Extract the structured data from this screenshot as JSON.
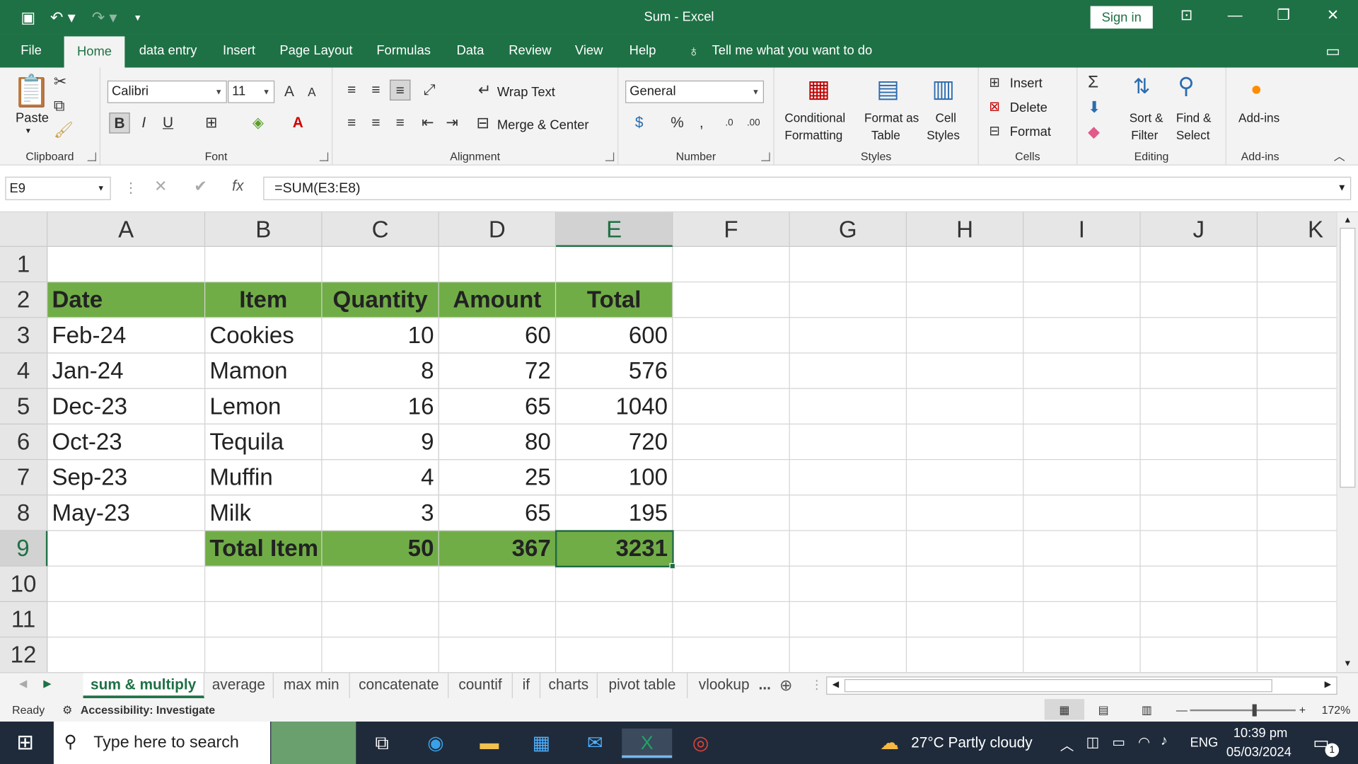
{
  "window": {
    "title": "Sum  -  Excel",
    "sign_in": "Sign in"
  },
  "menu_tabs": [
    "File",
    "Home",
    "data entry",
    "Insert",
    "Page Layout",
    "Formulas",
    "Data",
    "Review",
    "View",
    "Help"
  ],
  "tell_me": "Tell me what you want to do",
  "ribbon": {
    "clipboard": {
      "paste": "Paste",
      "label": "Clipboard"
    },
    "font": {
      "name": "Calibri",
      "size": "11",
      "label": "Font",
      "bold": "B",
      "italic": "I",
      "underline": "U"
    },
    "alignment": {
      "wrap": "Wrap Text",
      "merge": "Merge & Center",
      "label": "Alignment"
    },
    "number": {
      "format": "General",
      "label": "Number"
    },
    "styles": {
      "conditional": "Conditional",
      "conditional2": "Formatting",
      "format_as": "Format as",
      "format_as2": "Table",
      "cell": "Cell",
      "cell2": "Styles",
      "label": "Styles"
    },
    "cells": {
      "insert": "Insert",
      "delete": "Delete",
      "format": "Format",
      "label": "Cells"
    },
    "editing": {
      "sort": "Sort &",
      "sort2": "Filter",
      "find": "Find &",
      "find2": "Select",
      "label": "Editing"
    },
    "addins": {
      "addins": "Add-ins",
      "label": "Add-ins"
    }
  },
  "formula_bar": {
    "name_box": "E9",
    "formula": "=SUM(E3:E8)"
  },
  "columns": [
    "A",
    "B",
    "C",
    "D",
    "E",
    "F",
    "G",
    "H",
    "I",
    "J",
    "K"
  ],
  "rows": [
    "1",
    "2",
    "3",
    "4",
    "5",
    "6",
    "7",
    "8",
    "9",
    "10",
    "11",
    "12"
  ],
  "table": {
    "headers": [
      "Date",
      "Item",
      "Quantity",
      "Amount",
      "Total"
    ],
    "rows": [
      [
        "Feb-24",
        "Cookies",
        "10",
        "60",
        "600"
      ],
      [
        "Jan-24",
        "Mamon",
        "8",
        "72",
        "576"
      ],
      [
        "Dec-23",
        "Lemon",
        "16",
        "65",
        "1040"
      ],
      [
        "Oct-23",
        "Tequila",
        "9",
        "80",
        "720"
      ],
      [
        "Sep-23",
        "Muffin",
        "4",
        "25",
        "100"
      ],
      [
        "May-23",
        "Milk",
        "3",
        "65",
        "195"
      ]
    ],
    "total": {
      "label": "Total Item",
      "quantity": "50",
      "amount": "367",
      "total": "3231"
    }
  },
  "sheet_tabs": [
    "sum & multiply",
    "average",
    "max min",
    "concatenate",
    "countif",
    "if",
    "charts",
    "pivot table",
    "vlookup"
  ],
  "more_tabs": "...",
  "status": {
    "ready": "Ready",
    "accessibility": "Accessibility: Investigate",
    "zoom": "172%"
  },
  "taskbar": {
    "search": "Type here to search",
    "weather": "27°C  Partly cloudy",
    "lang": "ENG",
    "time": "10:39 pm",
    "date": "05/03/2024",
    "notif": "1"
  },
  "colors": {
    "brand": "#1e7145",
    "header_fill": "#70ad47"
  }
}
